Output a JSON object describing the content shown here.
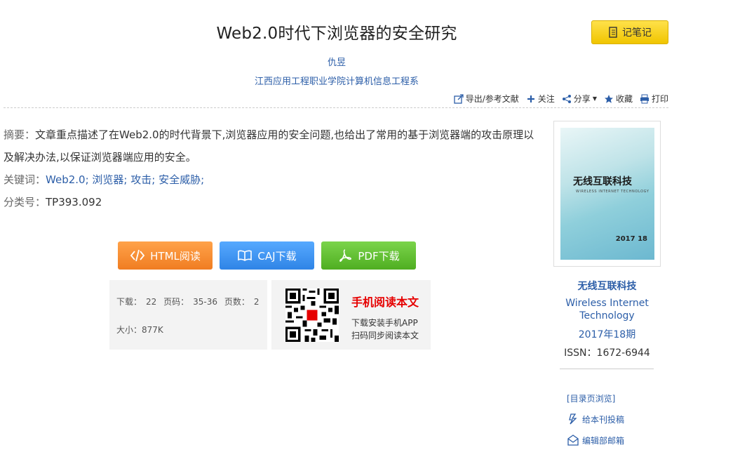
{
  "article": {
    "title": "Web2.0时代下浏览器的安全研究",
    "author": "仇昱",
    "organization": "江西应用工程职业学院计算机信息工程系"
  },
  "note_button": "记笔记",
  "toolbar": {
    "export": "导出/参考文献",
    "follow": "关注",
    "share": "分享",
    "favorite": "收藏",
    "print": "打印"
  },
  "meta": {
    "abstract_label": "摘要：",
    "abstract": "文章重点描述了在Web2.0的时代背景下,浏览器应用的安全问题,也给出了常用的基于浏览器端的攻击原理以及解决办法,以保证浏览器端应用的安全。",
    "keywords_label": "关键词：",
    "keywords": [
      "Web2.0;",
      "浏览器;",
      "攻击;",
      "安全威胁;"
    ],
    "class_label": "分类号：",
    "class_code": "TP393.092"
  },
  "buttons": {
    "html": "HTML阅读",
    "caj": "CAJ下载",
    "pdf": "PDF下载"
  },
  "stats": {
    "downloads_label": "下载：",
    "downloads": "22",
    "pages_label": "页码：",
    "pages": "35-36",
    "page_count_label": "页数：",
    "page_count": "2",
    "size_label": "大小：",
    "size": "877K"
  },
  "mobile": {
    "title": "手机阅读本文",
    "line1": "下载安装手机APP",
    "line2": "扫码同步阅读本文"
  },
  "journal": {
    "cover_title": "无线互联科技",
    "cover_sub": "WIRELESS INTERNET TECHNOLOGY",
    "cover_number": "2017 18",
    "name": "无线互联科技",
    "name_en": "Wireless Internet Technology",
    "issue": "2017年18期",
    "issn": "ISSN：1672-6944"
  },
  "side_links": {
    "toc": "[目录页浏览]",
    "submit": "给本刊投稿",
    "email": "编辑部邮箱"
  },
  "colors": {
    "link": "#2c5ea8",
    "html_btn": "#f07d22",
    "caj_btn": "#2f84e6",
    "pdf_btn": "#4fae21",
    "note_btn": "#f0c500",
    "mobile_title": "#e60000"
  }
}
